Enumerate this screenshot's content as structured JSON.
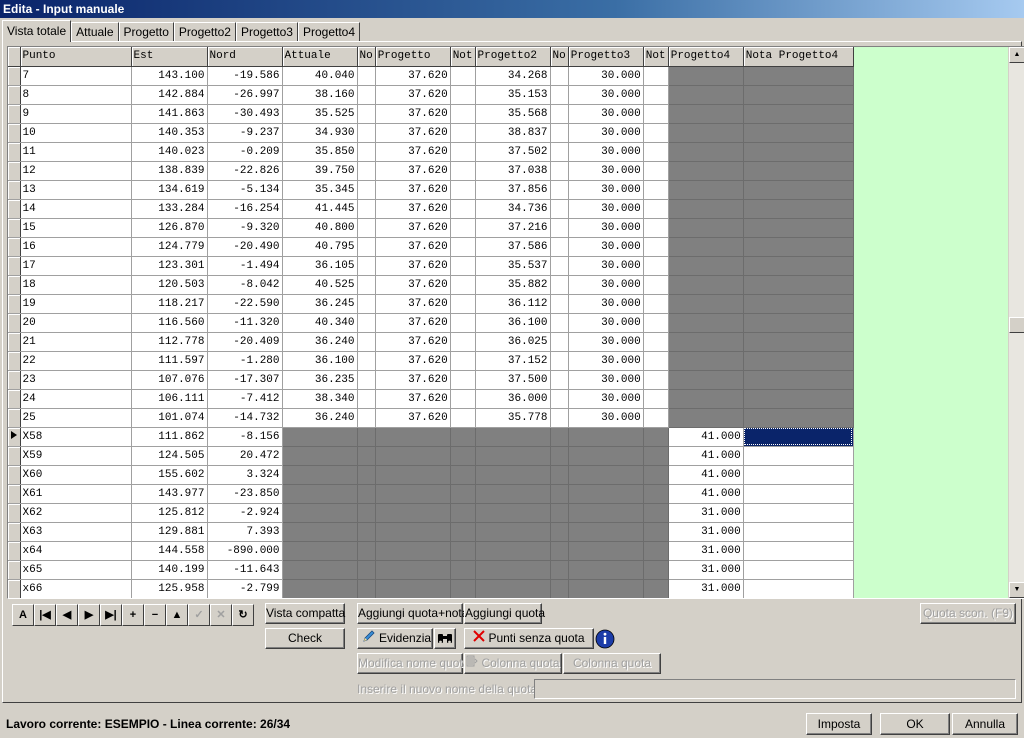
{
  "window": {
    "title": "Edita - Input manuale"
  },
  "tabs": [
    "Vista totale",
    "Attuale",
    "Progetto",
    "Progetto2",
    "Progetto3",
    "Progetto4"
  ],
  "grid": {
    "columns": [
      "Punto",
      "Est",
      "Nord",
      "Attuale",
      "No",
      "Progetto",
      "Not",
      "Progetto2",
      "No",
      "Progetto3",
      "Not",
      "Progetto4",
      "Nota Progetto4"
    ],
    "rows": [
      {
        "p": "7",
        "e": "143.100",
        "n": "-19.586",
        "a": "40.040",
        "p1": "37.620",
        "p2": "34.268",
        "p3": "30.000",
        "p4": ""
      },
      {
        "p": "8",
        "e": "142.884",
        "n": "-26.997",
        "a": "38.160",
        "p1": "37.620",
        "p2": "35.153",
        "p3": "30.000",
        "p4": ""
      },
      {
        "p": "9",
        "e": "141.863",
        "n": "-30.493",
        "a": "35.525",
        "p1": "37.620",
        "p2": "35.568",
        "p3": "30.000",
        "p4": ""
      },
      {
        "p": "10",
        "e": "140.353",
        "n": "-9.237",
        "a": "34.930",
        "p1": "37.620",
        "p2": "38.837",
        "p3": "30.000",
        "p4": ""
      },
      {
        "p": "11",
        "e": "140.023",
        "n": "-0.209",
        "a": "35.850",
        "p1": "37.620",
        "p2": "37.502",
        "p3": "30.000",
        "p4": ""
      },
      {
        "p": "12",
        "e": "138.839",
        "n": "-22.826",
        "a": "39.750",
        "p1": "37.620",
        "p2": "37.038",
        "p3": "30.000",
        "p4": ""
      },
      {
        "p": "13",
        "e": "134.619",
        "n": "-5.134",
        "a": "35.345",
        "p1": "37.620",
        "p2": "37.856",
        "p3": "30.000",
        "p4": ""
      },
      {
        "p": "14",
        "e": "133.284",
        "n": "-16.254",
        "a": "41.445",
        "p1": "37.620",
        "p2": "34.736",
        "p3": "30.000",
        "p4": ""
      },
      {
        "p": "15",
        "e": "126.870",
        "n": "-9.320",
        "a": "40.800",
        "p1": "37.620",
        "p2": "37.216",
        "p3": "30.000",
        "p4": ""
      },
      {
        "p": "16",
        "e": "124.779",
        "n": "-20.490",
        "a": "40.795",
        "p1": "37.620",
        "p2": "37.586",
        "p3": "30.000",
        "p4": ""
      },
      {
        "p": "17",
        "e": "123.301",
        "n": "-1.494",
        "a": "36.105",
        "p1": "37.620",
        "p2": "35.537",
        "p3": "30.000",
        "p4": ""
      },
      {
        "p": "18",
        "e": "120.503",
        "n": "-8.042",
        "a": "40.525",
        "p1": "37.620",
        "p2": "35.882",
        "p3": "30.000",
        "p4": ""
      },
      {
        "p": "19",
        "e": "118.217",
        "n": "-22.590",
        "a": "36.245",
        "p1": "37.620",
        "p2": "36.112",
        "p3": "30.000",
        "p4": ""
      },
      {
        "p": "20",
        "e": "116.560",
        "n": "-11.320",
        "a": "40.340",
        "p1": "37.620",
        "p2": "36.100",
        "p3": "30.000",
        "p4": ""
      },
      {
        "p": "21",
        "e": "112.778",
        "n": "-20.409",
        "a": "36.240",
        "p1": "37.620",
        "p2": "36.025",
        "p3": "30.000",
        "p4": ""
      },
      {
        "p": "22",
        "e": "111.597",
        "n": "-1.280",
        "a": "36.100",
        "p1": "37.620",
        "p2": "37.152",
        "p3": "30.000",
        "p4": ""
      },
      {
        "p": "23",
        "e": "107.076",
        "n": "-17.307",
        "a": "36.235",
        "p1": "37.620",
        "p2": "37.500",
        "p3": "30.000",
        "p4": ""
      },
      {
        "p": "24",
        "e": "106.111",
        "n": "-7.412",
        "a": "38.340",
        "p1": "37.620",
        "p2": "36.000",
        "p3": "30.000",
        "p4": ""
      },
      {
        "p": "25",
        "e": "101.074",
        "n": "-14.732",
        "a": "36.240",
        "p1": "37.620",
        "p2": "35.778",
        "p3": "30.000",
        "p4": ""
      },
      {
        "p": "X58",
        "e": "111.862",
        "n": "-8.156",
        "a": "",
        "p1": "",
        "p2": "",
        "p3": "",
        "p4": "41.000",
        "current": true
      },
      {
        "p": "X59",
        "e": "124.505",
        "n": "20.472",
        "a": "",
        "p1": "",
        "p2": "",
        "p3": "",
        "p4": "41.000"
      },
      {
        "p": "X60",
        "e": "155.602",
        "n": "3.324",
        "a": "",
        "p1": "",
        "p2": "",
        "p3": "",
        "p4": "41.000"
      },
      {
        "p": "X61",
        "e": "143.977",
        "n": "-23.850",
        "a": "",
        "p1": "",
        "p2": "",
        "p3": "",
        "p4": "41.000"
      },
      {
        "p": "X62",
        "e": "125.812",
        "n": "-2.924",
        "a": "",
        "p1": "",
        "p2": "",
        "p3": "",
        "p4": "31.000"
      },
      {
        "p": "X63",
        "e": "129.881",
        "n": "7.393",
        "a": "",
        "p1": "",
        "p2": "",
        "p3": "",
        "p4": "31.000"
      },
      {
        "p": "x64",
        "e": "144.558",
        "n": "-890.000",
        "a": "",
        "p1": "",
        "p2": "",
        "p3": "",
        "p4": "31.000"
      },
      {
        "p": "x65",
        "e": "140.199",
        "n": "-11.643",
        "a": "",
        "p1": "",
        "p2": "",
        "p3": "",
        "p4": "31.000"
      },
      {
        "p": "x66",
        "e": "125.958",
        "n": "-2.799",
        "a": "",
        "p1": "",
        "p2": "",
        "p3": "",
        "p4": "31.000"
      }
    ]
  },
  "navigator": {
    "buttons": [
      {
        "name": "filter-a-button",
        "glyph": "A",
        "enabled": true
      },
      {
        "name": "first-record-button",
        "glyph": "|◀",
        "enabled": true
      },
      {
        "name": "prior-record-button",
        "glyph": "◀",
        "enabled": true
      },
      {
        "name": "next-record-button",
        "glyph": "▶",
        "enabled": true
      },
      {
        "name": "last-record-button",
        "glyph": "▶|",
        "enabled": true
      },
      {
        "name": "insert-record-button",
        "glyph": "+",
        "enabled": true
      },
      {
        "name": "delete-record-button",
        "glyph": "−",
        "enabled": true
      },
      {
        "name": "edit-record-button",
        "glyph": "▲",
        "enabled": true
      },
      {
        "name": "post-record-button",
        "glyph": "✓",
        "enabled": false
      },
      {
        "name": "cancel-record-button",
        "glyph": "✕",
        "enabled": false
      },
      {
        "name": "refresh-record-button",
        "glyph": "↻",
        "enabled": true
      }
    ]
  },
  "actions": {
    "vista_compatta": "Vista compatta",
    "check": "Check",
    "aggiungi_quota_nota": "Aggiungi quota+nota",
    "aggiungi_quota": "Aggiungi quota",
    "evidenzia": "Evidenzia",
    "punti_senza_quota": "Punti senza quota",
    "modifica_nome_quota": "Modifica nome quota",
    "colonna_quota_1": "Colonna quota",
    "colonna_quota_2": "Colonna quota",
    "quota_scon": "Quota scon. (F9)",
    "new_name_label": "Inserire il nuovo nome della quota:"
  },
  "status": {
    "text": "Lavoro corrente: ESEMPIO - Linea corrente: 26/34",
    "imposta": "Imposta",
    "ok": "OK",
    "annulla": "Annulla"
  }
}
